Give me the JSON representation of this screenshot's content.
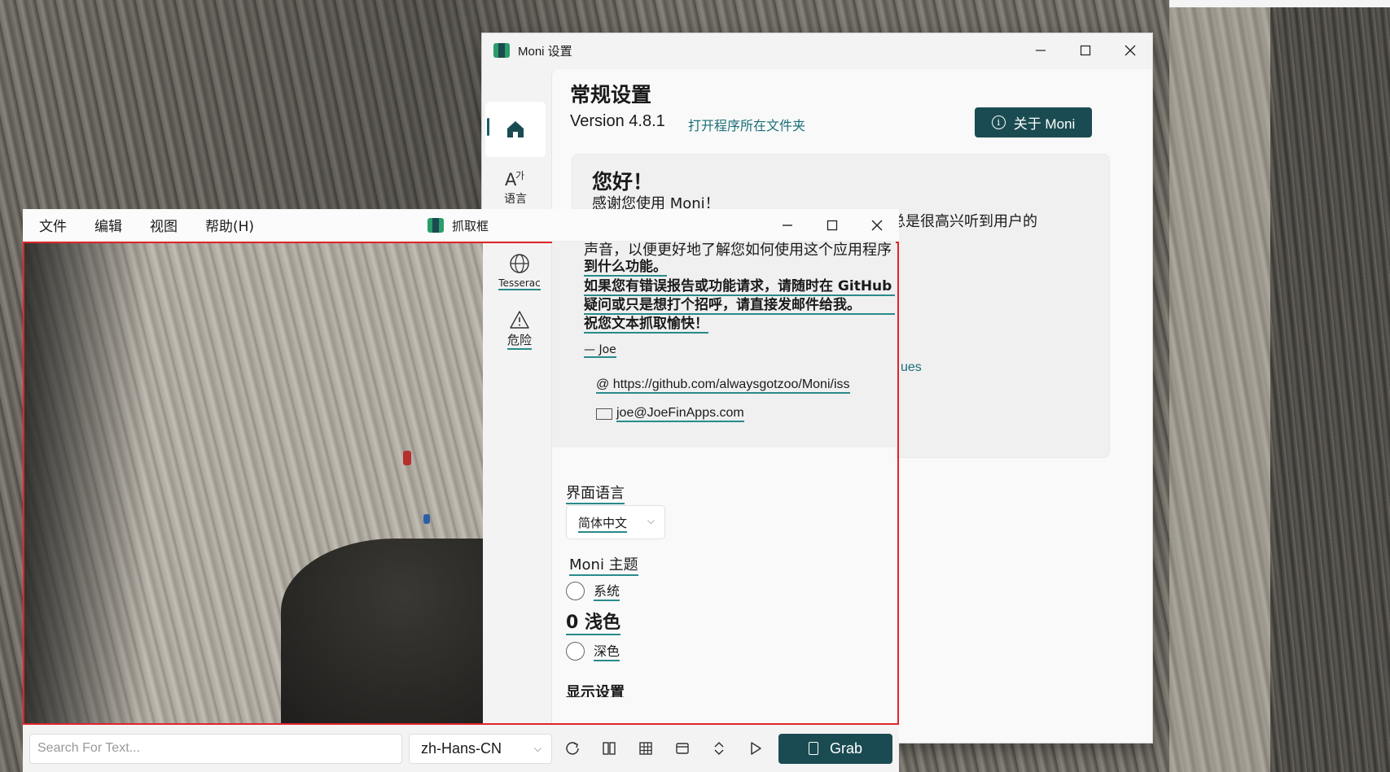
{
  "settings": {
    "title": "Moni 设置",
    "nav": [
      {
        "id": "home",
        "icon": "home-icon",
        "label": ""
      },
      {
        "id": "language",
        "icon": "language-icon",
        "label": "语言"
      },
      {
        "id": "display",
        "icon": "display-icon",
        "label": ""
      },
      {
        "id": "tesseract",
        "icon": "globe-icon",
        "label": "Tesserac"
      },
      {
        "id": "danger",
        "icon": "warning-icon",
        "label": "危险"
      }
    ],
    "heading": "常规设置",
    "version": "Version 4.8.1",
    "open_folder": "打开程序所在文件夹",
    "about_button": "关于 Moni",
    "card": {
      "hello": "您好！",
      "thanks": "感谢您使用 Moni！",
      "paragraph_line1_tail": "我总是很高兴听到用户的",
      "paragraph_line2": "声音，以便更好地了解您如何使用这个应用程序以及您希望在未来看",
      "paragraph_line3": "到什么功能。",
      "paragraph_line4": "如果您有错误报告或功能请求，请随时在 GitHub 上提出问题。如有",
      "paragraph_line5": "疑问或只是想打个招呼，请直接发邮件给我。",
      "paragraph_line6": "祝您文本抓取愉快！",
      "signature": "— Joe",
      "github_link_a": "@ https://github.com/alwaysgotzoo/Moni/iss",
      "github_link_b": "ues",
      "email": "joe@JoeFinApps.com"
    },
    "ui_language_label": "界面语言",
    "ui_language_value": "简体中文",
    "theme_label": "Moni 主题",
    "theme_options": [
      "系统",
      "0 浅色",
      "深色"
    ],
    "next_section_partial": "显示设置"
  },
  "grab": {
    "menu": [
      "文件",
      "编辑",
      "视图",
      "帮助(H)"
    ],
    "title": "抓取框",
    "search_placeholder": "Search For Text...",
    "language": "zh-Hans-CN",
    "grab_button": "Grab",
    "toolbar_icons": [
      "refresh-icon",
      "columns-icon",
      "table-icon",
      "window-icon",
      "up-down-icon",
      "play-icon"
    ]
  },
  "colors": {
    "accent": "#1b4b52",
    "link": "#1b6e78",
    "frame_border": "#e0242b"
  }
}
